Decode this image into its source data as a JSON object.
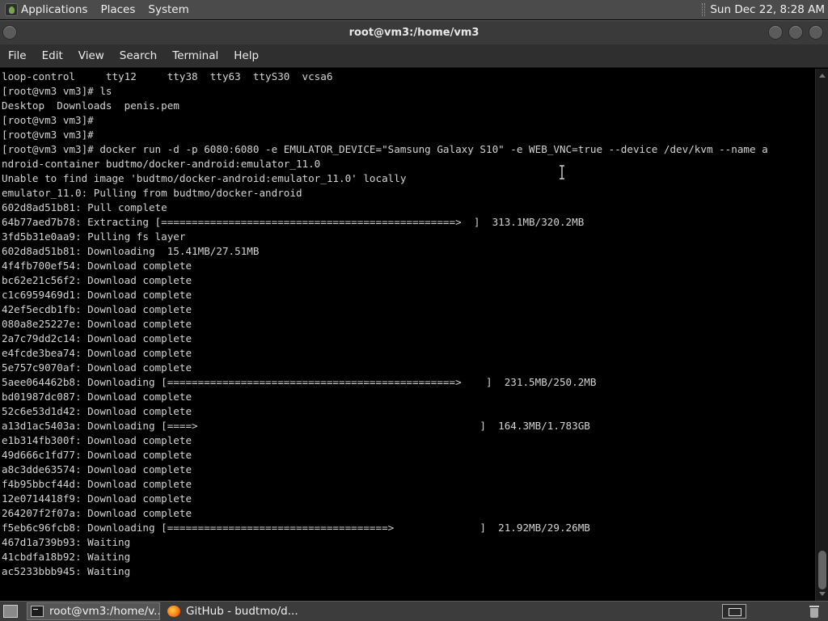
{
  "top_panel": {
    "menus": [
      "Applications",
      "Places",
      "System"
    ],
    "clock": "Sun Dec 22,  8:28 AM"
  },
  "window": {
    "title": "root@vm3:/home/vm3"
  },
  "menubar": {
    "items": [
      "File",
      "Edit",
      "View",
      "Search",
      "Terminal",
      "Help"
    ]
  },
  "terminal": {
    "lines": [
      "loop-control     tty12     tty38  tty63  ttyS30  vcsa6",
      "[root@vm3 vm3]# ls",
      "Desktop  Downloads  penis.pem",
      "[root@vm3 vm3]#",
      "[root@vm3 vm3]#",
      "[root@vm3 vm3]# docker run -d -p 6080:6080 -e EMULATOR_DEVICE=\"Samsung Galaxy S10\" -e WEB_VNC=true --device /dev/kvm --name a",
      "ndroid-container budtmo/docker-android:emulator_11.0",
      "Unable to find image 'budtmo/docker-android:emulator_11.0' locally",
      "emulator_11.0: Pulling from budtmo/docker-android",
      "602d8ad51b81: Pull complete",
      "64b77aed7b78: Extracting [================================================>  ]  313.1MB/320.2MB",
      "3fd5b31e0aa9: Pulling fs layer",
      "602d8ad51b81: Downloading  15.41MB/27.51MB",
      "4f4fb700ef54: Download complete",
      "bc62e21c56f2: Download complete",
      "c1c6959469d1: Download complete",
      "42ef5ecdb1fb: Download complete",
      "080a8e25227e: Download complete",
      "2a7c79dd2c14: Download complete",
      "e4fcde3bea74: Download complete",
      "5e757c9070af: Download complete",
      "5aee064462b8: Downloading [===============================================>    ]  231.5MB/250.2MB",
      "bd01987dc087: Download complete",
      "52c6e53d1d42: Download complete",
      "a13d1ac5403a: Downloading [====>                                              ]  164.3MB/1.783GB",
      "e1b314fb300f: Download complete",
      "49d666c1fd77: Download complete",
      "a8c3dde63574: Download complete",
      "f4b95bbcf44d: Download complete",
      "12e0714418f9: Download complete",
      "264207f2f07a: Download complete",
      "f5eb6c96fcb8: Downloading [====================================>              ]  21.92MB/29.26MB",
      "467d1a739b93: Waiting",
      "41cbdfa18b92: Waiting",
      "ac5233bbb945: Waiting"
    ]
  },
  "taskbar": {
    "tasks": [
      {
        "label": "root@vm3:/home/v...",
        "icon": "terminal-icon",
        "active": true
      },
      {
        "label": "GitHub - budtmo/d...",
        "icon": "firefox-icon",
        "active": false
      }
    ]
  },
  "colors": {
    "terminal_bg": "#000000",
    "terminal_fg": "#d4d4d4",
    "panel_bg": "#4b4b4b"
  }
}
